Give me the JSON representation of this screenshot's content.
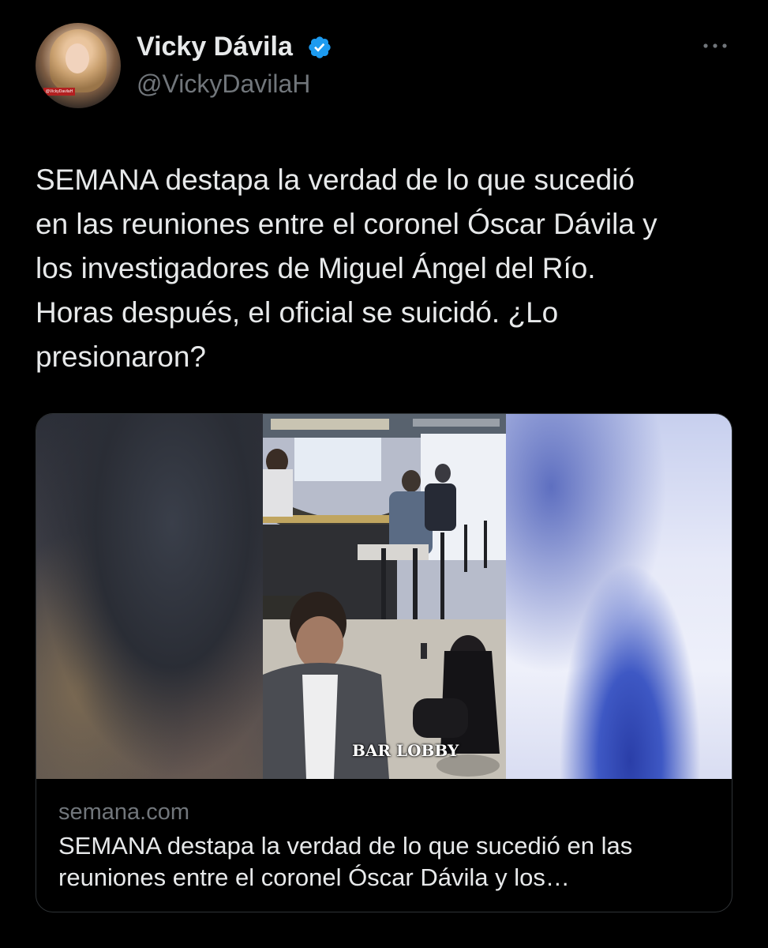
{
  "user": {
    "name": "Vicky Dávila",
    "handle": "@VickyDavilaH",
    "verified": true,
    "avatar_label": "@VickyDavilaH"
  },
  "tweet": {
    "text": "SEMANA destapa la verdad de lo que sucedió\nen las reuniones entre el coronel Óscar Dávila y\nlos investigadores de Miguel Ángel del Río.\nHoras después, el oficial se suicidó. ¿Lo\npresionaron?"
  },
  "card": {
    "image_overlay_text": "BAR LOBBY",
    "domain": "semana.com",
    "title": "SEMANA destapa la verdad de lo que sucedió en las reuniones entre el coronel Óscar Dávila y los…"
  },
  "icons": {
    "verified": "verified-badge-icon",
    "more": "more-options-icon"
  },
  "colors": {
    "background": "#000000",
    "text_primary": "#e7e9ea",
    "text_secondary": "#71767b",
    "verified_blue": "#1d9bf0",
    "card_border": "#2f3336"
  }
}
